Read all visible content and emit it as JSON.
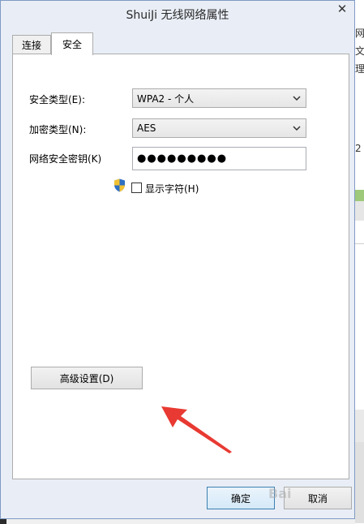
{
  "window": {
    "title": "ShuiJi 无线网络属性",
    "close_glyph": "✕"
  },
  "tabs": [
    {
      "label": "连接"
    },
    {
      "label": "安全"
    }
  ],
  "security": {
    "security_type_label": "安全类型(E):",
    "security_type_value": "WPA2 - 个人",
    "encryption_type_label": "加密类型(N):",
    "encryption_type_value": "AES",
    "network_key_label": "网络安全密钥(K)",
    "network_key_value": "●●●●●●●●●",
    "show_characters_label": "显示字符(H)",
    "advanced_button_label": "高级设置(D)"
  },
  "footer": {
    "ok_label": "确定",
    "cancel_label": "取消"
  },
  "background_fragments": [
    "网",
    "文",
    "理",
    "2"
  ],
  "watermark": "Bai"
}
